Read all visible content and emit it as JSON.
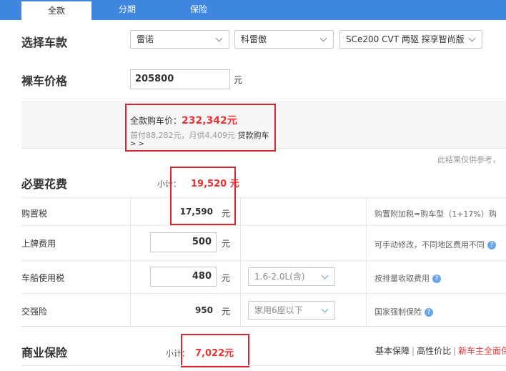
{
  "tabs": [
    {
      "label": "全款",
      "active": true
    },
    {
      "label": "分期",
      "active": false
    },
    {
      "label": "保险",
      "active": false
    }
  ],
  "select_model": {
    "title": "选择车款",
    "brand": "雷诺",
    "series": "科雷傲",
    "model": "SCe200 CVT 两驱 探享智尚版"
  },
  "bare_price": {
    "title": "裸车价格",
    "value": "205800",
    "unit": "元"
  },
  "summary": {
    "total_label": "全款购车价：",
    "total_amount": "232,342元",
    "loan_text": "首付88,282元，月供4,409元",
    "loan_link": "贷款购车",
    "arrows": "> >",
    "note": "此结果仅供参考，"
  },
  "required": {
    "title": "必要花费",
    "subtotal_label": "小计：",
    "subtotal_amount": "19,520 元",
    "rows": [
      {
        "label": "购置税",
        "value": "17,590",
        "unit": "元",
        "desc": "购置附加税=购车型（1+17%）购"
      },
      {
        "label": "上牌费用",
        "value": "500",
        "unit": "元",
        "desc": "可手动修改，不同地区费用不同"
      },
      {
        "label": "车船使用税",
        "value": "480",
        "unit": "元",
        "select": "1.6-2.0L(含)",
        "desc": "按排量收取费用"
      },
      {
        "label": "交强险",
        "value": "950",
        "unit": "元",
        "select": "家用6座以下",
        "desc": "国家强制保险"
      }
    ]
  },
  "insurance": {
    "title": "商业保险",
    "subtotal_label": "小计：",
    "subtotal_amount": "7,022元",
    "links": [
      "基本保障",
      "高性价比",
      "新车主全面保"
    ]
  },
  "colors": {
    "tab_bar": "#3f86de",
    "highlight_box": "#d9262e",
    "amount_red": "#ee3333"
  }
}
